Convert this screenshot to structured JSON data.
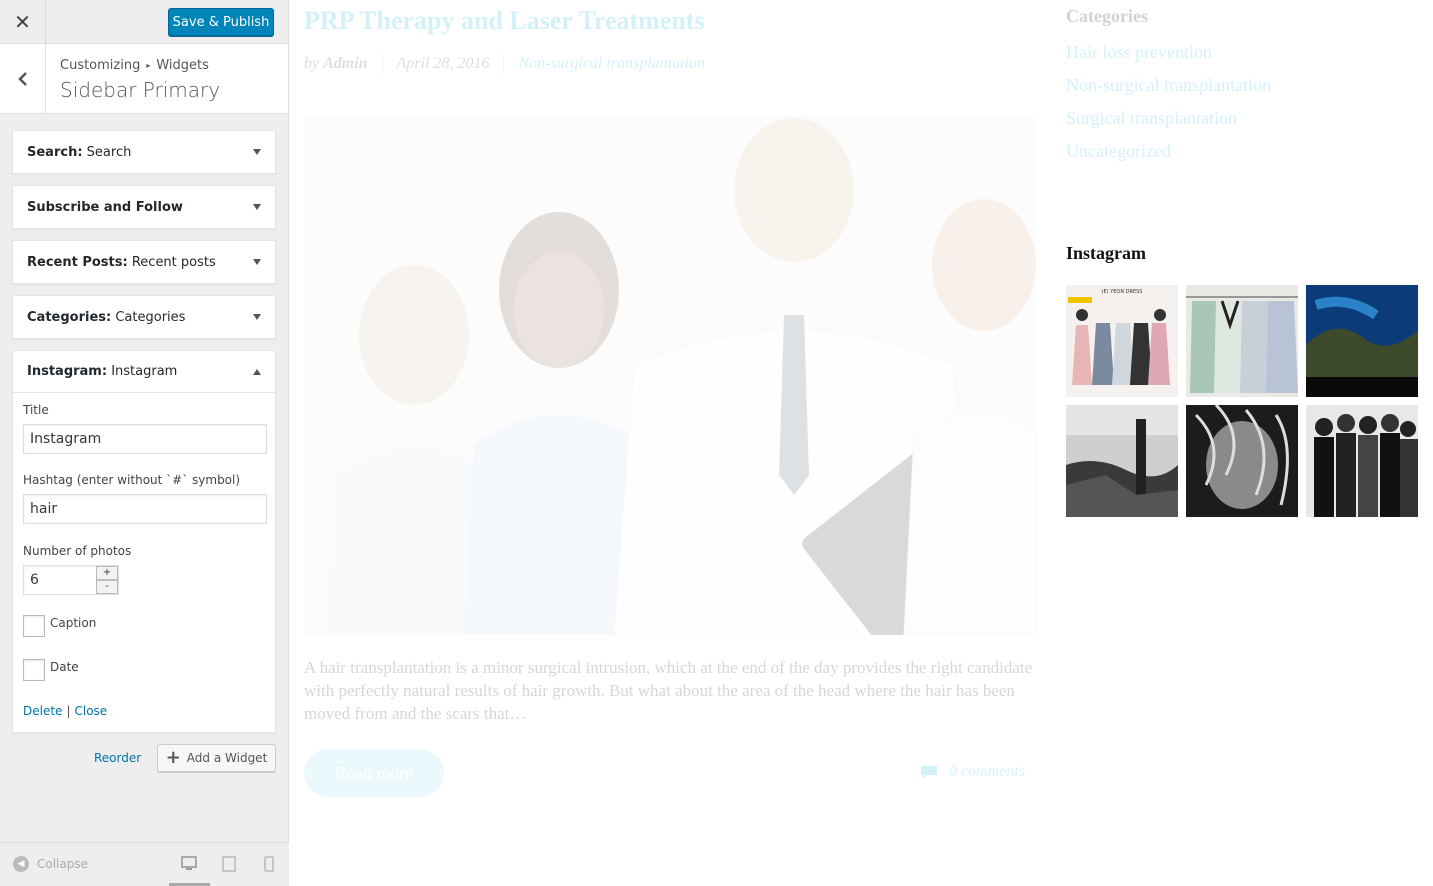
{
  "topbar": {
    "close_glyph": "✕",
    "publish_label": "Save & Publish"
  },
  "section": {
    "breadcrumb": [
      "Customizing",
      "Widgets"
    ],
    "breadcrumb_sep": "▸",
    "title": "Sidebar Primary"
  },
  "widgets": [
    {
      "name": "Search:",
      "sub": "Search"
    },
    {
      "name": "Subscribe and Follow",
      "sub": ""
    },
    {
      "name": "Recent Posts:",
      "sub": "Recent posts"
    },
    {
      "name": "Categories:",
      "sub": "Categories"
    }
  ],
  "instagram_widget": {
    "name": "Instagram:",
    "sub": "Instagram",
    "title_label": "Title",
    "title_value": "Instagram",
    "hashtag_label": "Hashtag (enter without `#` symbol)",
    "hashtag_value": "hair",
    "photos_label": "Number of photos",
    "photos_value": "6",
    "step_up": "+",
    "step_down": "-",
    "caption_label": "Caption",
    "date_label": "Date",
    "delete_label": "Delete",
    "pipe": "|",
    "close_label": "Close"
  },
  "actions": {
    "reorder_label": "Reorder",
    "add_plus": "+",
    "add_widget_label": "Add a Widget"
  },
  "footer": {
    "collapse_label": "Collapse"
  },
  "preview": {
    "post_title": "PRP Therapy and Laser Treatments",
    "by": "by",
    "author": "Admin",
    "date": "April 28, 2016",
    "category": "Non-surgical transplantation",
    "excerpt": "A hair transplantation is a minor surgical intrusion, which at the end of the day provides the right candidate with perfectly natural results of hair growth. But what about  the area of the head where the hair has been moved from and the scars that…",
    "read_more": "Read more",
    "comments": "0 comments",
    "categories_heading": "Categories",
    "categories": [
      "Hair loss prevention",
      "Non-surgical transplantation",
      "Surgical transplantation",
      "Uncategorized"
    ],
    "instagram_heading": "Instagram",
    "photo_label": "(E) YEON DRESS"
  },
  "colors": {
    "accent": "#0085ba",
    "link": "#0073aa",
    "theme": "#2bb8e0"
  }
}
